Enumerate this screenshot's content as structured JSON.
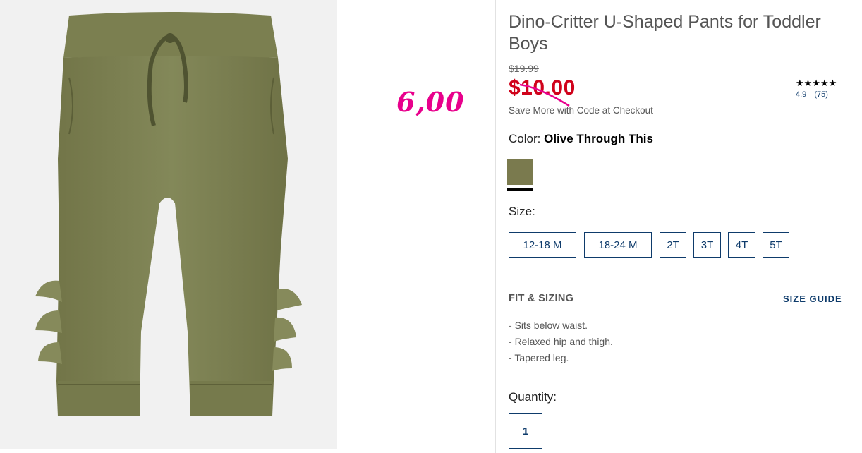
{
  "product": {
    "title": "Dino-Critter U-Shaped Pants for Toddler Boys",
    "old_price": "$19.99",
    "sale_price": "$10.00",
    "save_more": "Save More with Code at Checkout",
    "rating": {
      "stars": "★★★★★",
      "score": "4.9",
      "count": "(75)"
    },
    "color_label": "Color:",
    "color_value": "Olive Through This",
    "size_label": "Size:",
    "sizes": [
      "12-18 M",
      "18-24 M",
      "2T",
      "3T",
      "4T",
      "5T"
    ],
    "fit_heading": "FIT & SIZING",
    "size_guide": "SIZE GUIDE",
    "fit_points": [
      "Sits below waist.",
      "Relaxed hip and thigh.",
      "Tapered leg."
    ],
    "quantity_label": "Quantity:",
    "quantity_value": "1"
  },
  "annotation": {
    "text": "6,00",
    "color": "#e8008c"
  },
  "colors": {
    "accent": "#0e3b6b",
    "sale": "#d0021b",
    "swatch": "#7a7a4e",
    "product_photo": "#7f8354"
  }
}
